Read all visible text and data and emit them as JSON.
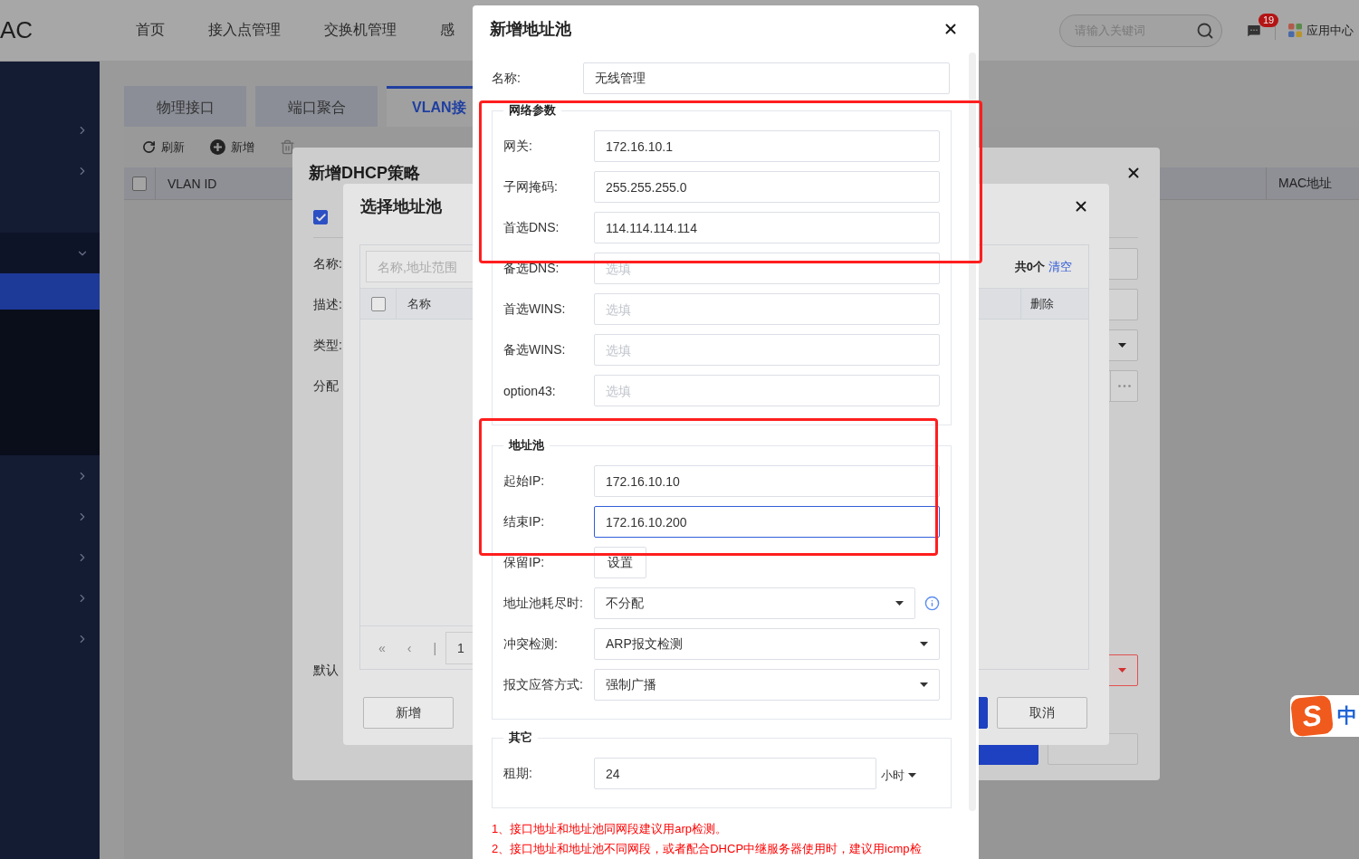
{
  "header": {
    "logo": "AC",
    "nav": [
      {
        "label": "首页"
      },
      {
        "label": "接入点管理"
      },
      {
        "label": "交换机管理"
      },
      {
        "label": "感"
      }
    ],
    "search": {
      "placeholder": "请输入关键词"
    },
    "message_count": "19",
    "app_center": "应用中心"
  },
  "sidebar": {
    "items": [
      {
        "kind": "group",
        "expanded": false
      },
      {
        "kind": "group",
        "expanded": false
      },
      {
        "kind": "leaf"
      },
      {
        "kind": "group",
        "expanded": true,
        "children": [
          {
            "selected": true
          }
        ]
      },
      {
        "kind": "group",
        "expanded": false
      },
      {
        "kind": "group",
        "expanded": false
      },
      {
        "kind": "group",
        "expanded": false
      },
      {
        "kind": "group",
        "expanded": false
      },
      {
        "kind": "group",
        "expanded": false
      }
    ]
  },
  "tabs": [
    {
      "label": "物理接口",
      "selected": false
    },
    {
      "label": "端口聚合",
      "selected": false
    },
    {
      "label": "VLAN接",
      "selected": true
    }
  ],
  "toolbar": [
    {
      "label": "刷新",
      "kind": "refresh",
      "disabled": false
    },
    {
      "label": "新增",
      "kind": "add",
      "disabled": false
    },
    {
      "kind": "delete",
      "disabled": true
    }
  ],
  "table": {
    "select_all_checked": false,
    "columns": [
      "VLAN ID",
      "MAC地址"
    ]
  },
  "dhcp_dialog": {
    "title": "新增DHCP策略",
    "enable": {
      "checked": true
    },
    "fields": [
      {
        "label": "名称:",
        "kind": "input",
        "invalid": false
      },
      {
        "label": "描述:",
        "kind": "input",
        "invalid": false
      },
      {
        "label": "类型:",
        "kind": "select",
        "invalid": false
      },
      {
        "label": "分配",
        "kind": "list",
        "invalid": false
      },
      {
        "label": "默认",
        "kind": "select",
        "invalid": true
      }
    ],
    "buttons": [
      {
        "kind": "primary"
      },
      {
        "kind": "default"
      }
    ]
  },
  "pool_select_dialog": {
    "title": "选择地址池",
    "search": {
      "placeholder": "名称,地址范围"
    },
    "select_all_checked": false,
    "available_columns": [
      "名称"
    ],
    "pager": [
      "«",
      "‹",
      "|"
    ],
    "page": "1",
    "summary": "共0个",
    "clear_link": "清空",
    "selected_columns": [
      "删除"
    ],
    "buttons": [
      {
        "label": "新增",
        "kind": "default"
      },
      {
        "kind": "primary"
      },
      {
        "label": "取消",
        "kind": "default"
      }
    ]
  },
  "pool_dialog": {
    "title": "新增地址池",
    "name": {
      "label": "名称:",
      "value": "无线管理"
    },
    "sections": [
      {
        "legend": "网络参数",
        "fields": [
          {
            "label": "网关:",
            "kind": "input",
            "value": "172.16.10.1",
            "focused": false
          },
          {
            "label": "子网掩码:",
            "kind": "input",
            "value": "255.255.255.0",
            "focused": false
          },
          {
            "label": "首选DNS:",
            "kind": "input",
            "value": "114.114.114.114",
            "focused": false
          },
          {
            "label": "备选DNS:",
            "kind": "input",
            "placeholder": "选填",
            "focused": false
          },
          {
            "label": "首选WINS:",
            "kind": "input",
            "placeholder": "选填",
            "focused": false
          },
          {
            "label": "备选WINS:",
            "kind": "input",
            "placeholder": "选填",
            "focused": false
          },
          {
            "label": "option43:",
            "kind": "input",
            "placeholder": "选填",
            "focused": false
          }
        ]
      },
      {
        "legend": "地址池",
        "fields": [
          {
            "label": "起始IP:",
            "kind": "input",
            "value": "172.16.10.10",
            "focused": false
          },
          {
            "label": "结束IP:",
            "kind": "input",
            "value": "172.16.10.200",
            "focused": true
          },
          {
            "label": "保留IP:",
            "kind": "button",
            "value": "设置"
          },
          {
            "label": "地址池耗尽时:",
            "kind": "select",
            "value": "不分配",
            "info": true
          },
          {
            "label": "冲突检测:",
            "kind": "select",
            "value": "ARP报文检测",
            "info": false
          },
          {
            "label": "报文应答方式:",
            "kind": "select",
            "value": "强制广播",
            "info": false
          }
        ]
      },
      {
        "legend": "其它",
        "fields": [
          {
            "label": "租期:",
            "kind": "input",
            "value": "24",
            "unit": "小时",
            "focused": false
          }
        ]
      }
    ],
    "notes": [
      "1、接口地址和地址池同网段建议用arp检测。",
      "2、接口地址和地址池不同网段，或者配合DHCP中继服务器使用时，建议用icmp检"
    ]
  },
  "annotations": [
    {
      "kind": "frame"
    },
    {
      "kind": "frame"
    }
  ],
  "ime_indicator": {
    "logo": "S",
    "mode": "中"
  }
}
